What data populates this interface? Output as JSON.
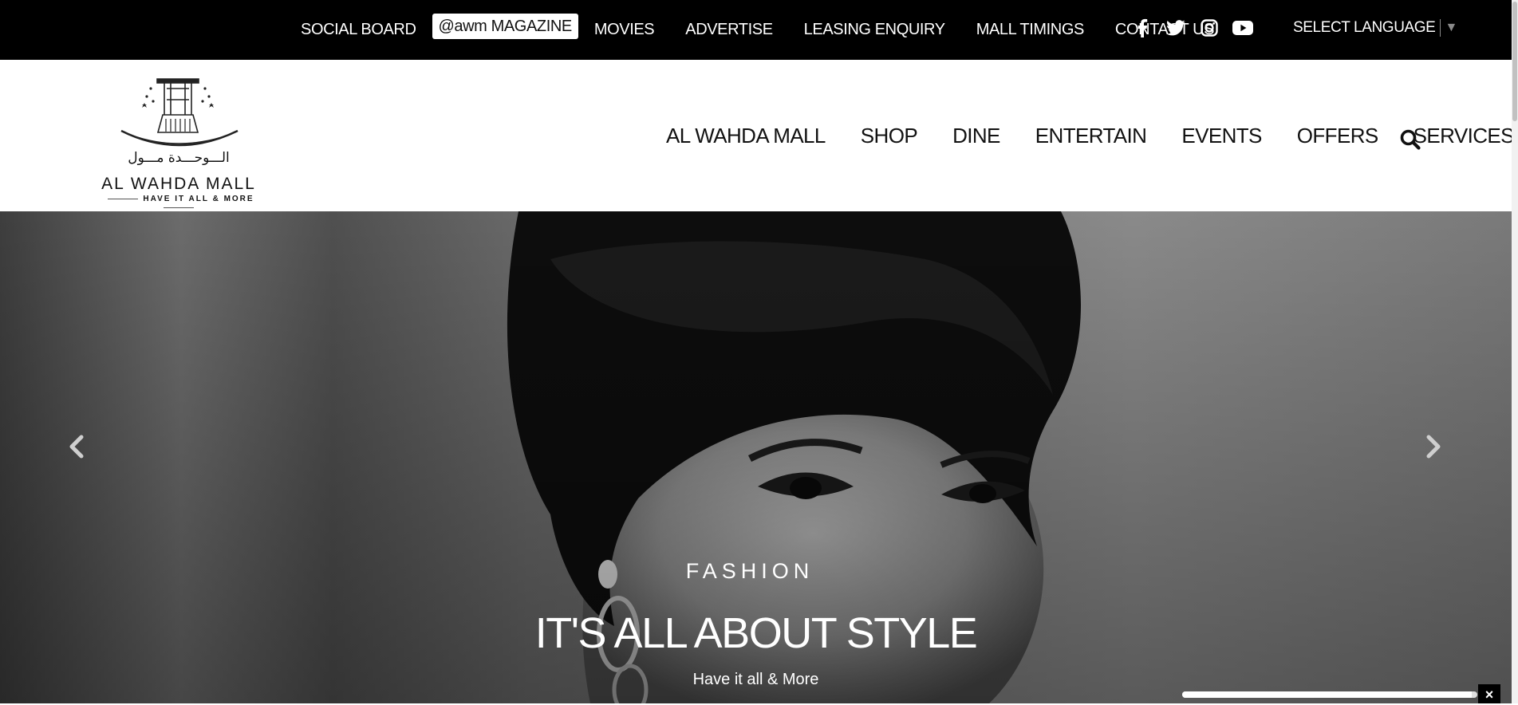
{
  "topbar": {
    "links": [
      {
        "label": "SOCIAL BOARD"
      },
      {
        "label": "@awm MAGAZINE"
      },
      {
        "label": "MOVIES"
      },
      {
        "label": "ADVERTISE"
      },
      {
        "label": "LEASING ENQUIRY"
      },
      {
        "label": "MALL TIMINGS"
      },
      {
        "label": "CONTACT US"
      }
    ],
    "social": [
      "facebook-icon",
      "twitter-icon",
      "instagram-icon",
      "youtube-icon"
    ],
    "language_label": "SELECT LANGUAGE",
    "language_caret": "▼"
  },
  "header": {
    "logo": {
      "arabic": "الـــوحـــدة مـــول",
      "title": "AL WAHDA MALL",
      "tagline": "HAVE IT ALL & MORE"
    },
    "nav": [
      {
        "label": "AL WAHDA MALL"
      },
      {
        "label": "SHOP"
      },
      {
        "label": "DINE"
      },
      {
        "label": "ENTERTAIN"
      },
      {
        "label": "EVENTS"
      },
      {
        "label": "OFFERS"
      },
      {
        "label": "SERVICES"
      }
    ]
  },
  "hero": {
    "category": "FASHION",
    "title": "IT'S ALL ABOUT STYLE",
    "subtitle": "Have it all & More",
    "slide_progress": 0.98,
    "close_label": "×"
  }
}
